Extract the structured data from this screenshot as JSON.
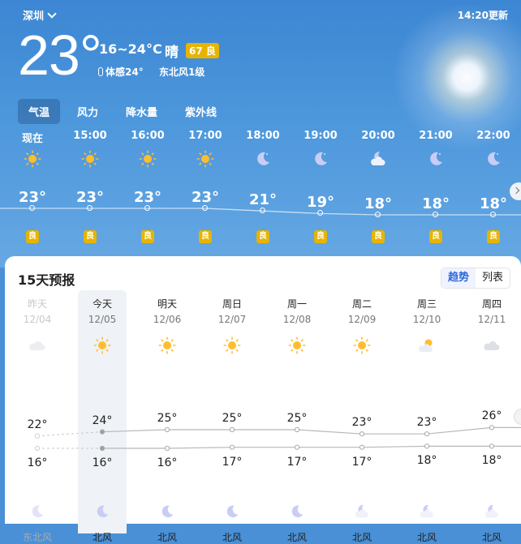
{
  "header": {
    "city": "深圳",
    "update_time": "14:20更新",
    "current_temp": "23°",
    "temp_range": "16~24°C",
    "condition": "晴",
    "aqi": "67 良",
    "feels_like": "体感24°",
    "wind": "东北风1级"
  },
  "tabs": [
    "气温",
    "风力",
    "降水量",
    "紫外线"
  ],
  "hourly": [
    {
      "time": "现在",
      "icon": "sun-icon",
      "temp": "23°",
      "temp_value": 23,
      "aqi": "良"
    },
    {
      "time": "15:00",
      "icon": "sun-icon",
      "temp": "23°",
      "temp_value": 23,
      "aqi": "良"
    },
    {
      "time": "16:00",
      "icon": "sun-icon",
      "temp": "23°",
      "temp_value": 23,
      "aqi": "良"
    },
    {
      "time": "17:00",
      "icon": "sun-icon",
      "temp": "23°",
      "temp_value": 23,
      "aqi": "良"
    },
    {
      "time": "18:00",
      "icon": "moon-icon",
      "temp": "21°",
      "temp_value": 21,
      "aqi": "良"
    },
    {
      "time": "19:00",
      "icon": "moon-icon",
      "temp": "19°",
      "temp_value": 19,
      "aqi": "良"
    },
    {
      "time": "20:00",
      "icon": "moon-cloud-icon",
      "temp": "18°",
      "temp_value": 18,
      "aqi": "良"
    },
    {
      "time": "21:00",
      "icon": "moon-icon",
      "temp": "18°",
      "temp_value": 18,
      "aqi": "良"
    },
    {
      "time": "22:00",
      "icon": "moon-icon",
      "temp": "18°",
      "temp_value": 18,
      "aqi": "良"
    }
  ],
  "forecast": {
    "title": "15天预报",
    "toggle": [
      "趋势",
      "列表"
    ],
    "days": [
      {
        "name": "昨天",
        "date": "12/04",
        "day_icon": "cloud-icon",
        "high": "22°",
        "high_value": 22,
        "low": "16°",
        "low_value": 16,
        "night_icon": "moon-icon",
        "wind": "东北风"
      },
      {
        "name": "今天",
        "date": "12/05",
        "day_icon": "sun-icon",
        "high": "24°",
        "high_value": 24,
        "low": "16°",
        "low_value": 16,
        "night_icon": "moon-icon",
        "wind": "北风"
      },
      {
        "name": "明天",
        "date": "12/06",
        "day_icon": "sun-icon",
        "high": "25°",
        "high_value": 25,
        "low": "16°",
        "low_value": 16,
        "night_icon": "moon-icon",
        "wind": "北风"
      },
      {
        "name": "周日",
        "date": "12/07",
        "day_icon": "sun-icon",
        "high": "25°",
        "high_value": 25,
        "low": "17°",
        "low_value": 17,
        "night_icon": "moon-icon",
        "wind": "北风"
      },
      {
        "name": "周一",
        "date": "12/08",
        "day_icon": "sun-icon",
        "high": "25°",
        "high_value": 25,
        "low": "17°",
        "low_value": 17,
        "night_icon": "moon-icon",
        "wind": "北风"
      },
      {
        "name": "周二",
        "date": "12/09",
        "day_icon": "sun-icon",
        "high": "23°",
        "high_value": 23,
        "low": "17°",
        "low_value": 17,
        "night_icon": "moon-cloud-icon",
        "wind": "北风"
      },
      {
        "name": "周三",
        "date": "12/10",
        "day_icon": "sun-cloud-icon",
        "high": "23°",
        "high_value": 23,
        "low": "18°",
        "low_value": 18,
        "night_icon": "moon-cloud-icon",
        "wind": "北风"
      },
      {
        "name": "周四",
        "date": "12/11",
        "day_icon": "cloud-icon",
        "high": "26°",
        "high_value": 26,
        "low": "18°",
        "low_value": 18,
        "night_icon": "moon-cloud-icon",
        "wind": "北风"
      }
    ]
  },
  "colors": {
    "sky": "#4a90d6",
    "aqi_good": "#e7b400",
    "accent": "#2f67d9"
  }
}
